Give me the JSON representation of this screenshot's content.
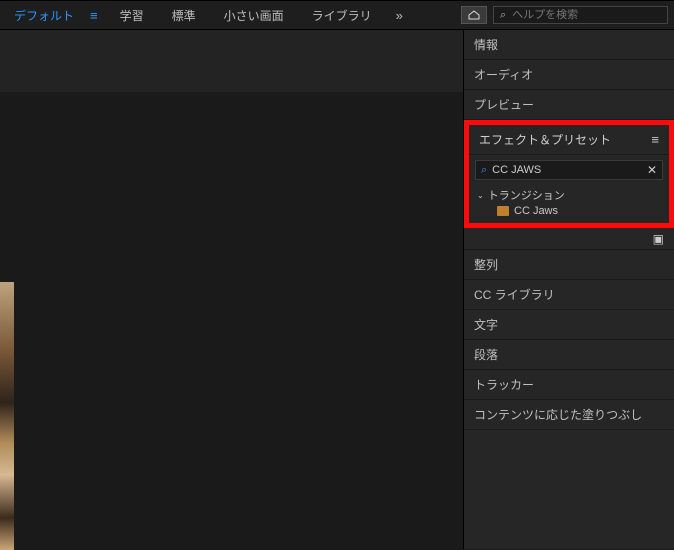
{
  "topbar": {
    "workspaces": {
      "default": "デフォルト",
      "learn": "学習",
      "standard": "標準",
      "small": "小さい画面",
      "library": "ライブラリ"
    },
    "help_placeholder": "ヘルプを検索"
  },
  "panels": {
    "info": "情報",
    "audio": "オーディオ",
    "preview": "プレビュー",
    "effects": {
      "title": "エフェクト＆プリセット",
      "search_value": "CC JAWS",
      "category": "トランジション",
      "item": "CC Jaws"
    },
    "align": "整列",
    "cc_library": "CC ライブラリ",
    "text": "文字",
    "paragraph": "段落",
    "tracker": "トラッカー",
    "content_fill": "コンテンツに応じた塗りつぶし"
  }
}
